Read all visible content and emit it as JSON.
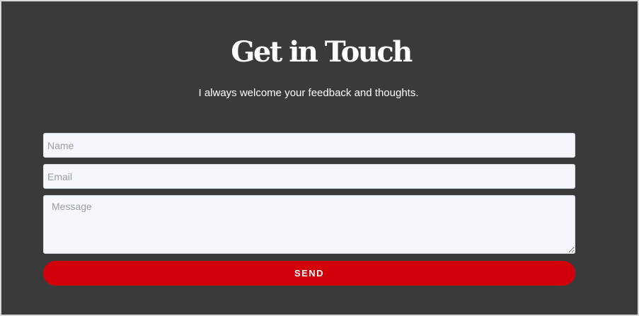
{
  "contact": {
    "title": "Get in Touch",
    "subtitle": "I always welcome your feedback and thoughts.",
    "name_placeholder": "Name",
    "email_placeholder": "Email",
    "message_placeholder": "Message",
    "send_label": "SEND"
  },
  "colors": {
    "background": "#3a3a3a",
    "field_background": "#f4f8fc",
    "button": "#d2000b",
    "text": "#ffffff"
  }
}
